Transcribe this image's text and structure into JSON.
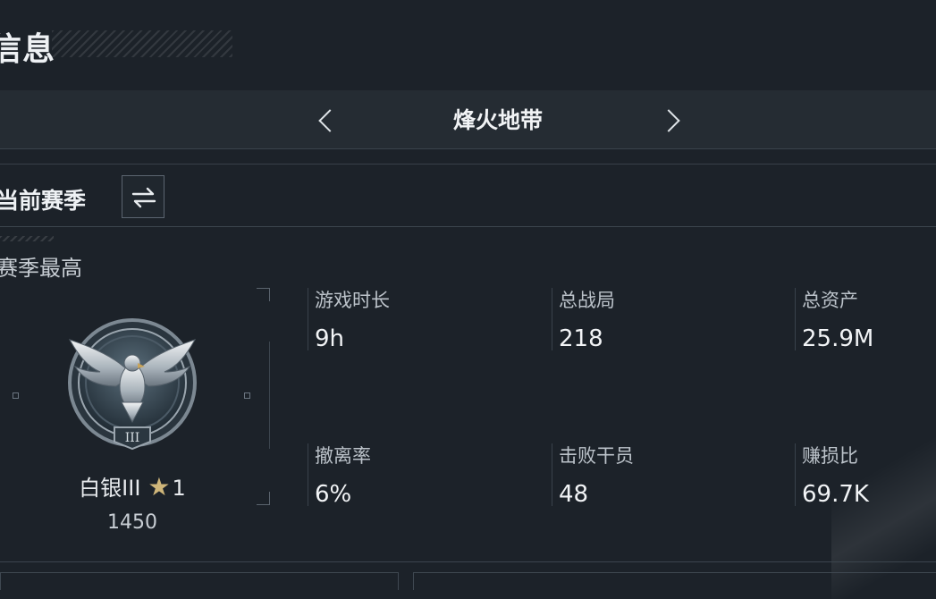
{
  "header": {
    "title": "信息"
  },
  "mode_selector": {
    "title": "烽火地带",
    "prev_icon": "chevron-left-icon",
    "next_icon": "chevron-right-icon"
  },
  "season": {
    "label": "当前赛季",
    "switch_icon": "swap-arrows-icon"
  },
  "best": {
    "label": "赛季最高",
    "rank_name": "白银III",
    "rank_stars": "1",
    "star_icon": "star-icon",
    "rank_numeral": "III",
    "score": "1450"
  },
  "stats": {
    "play_time": {
      "label": "游戏时长",
      "value": "9h"
    },
    "total_matches": {
      "label": "总战局",
      "value": "218"
    },
    "total_assets": {
      "label": "总资产",
      "value": "25.9M"
    },
    "extraction_rate": {
      "label": "撤离率",
      "value": "6%"
    },
    "operators_defeated": {
      "label": "击败干员",
      "value": "48"
    },
    "profit_ratio": {
      "label": "赚损比",
      "value": "69.7K"
    }
  },
  "colors": {
    "background": "#1c2229",
    "bar": "#252c33",
    "gold_star": "#cfb67a"
  }
}
